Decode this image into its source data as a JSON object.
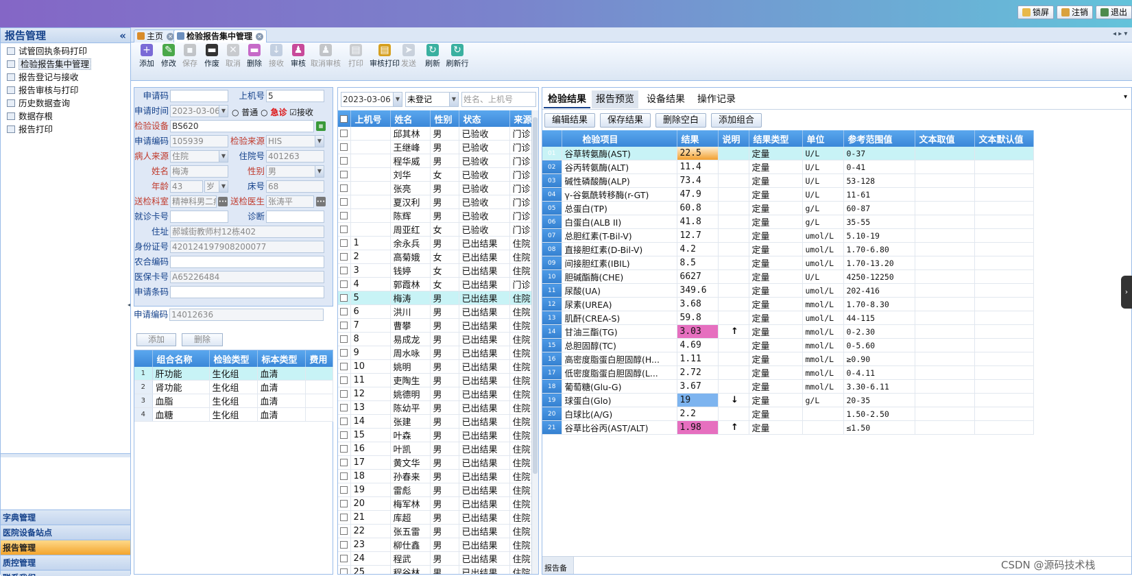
{
  "top_buttons": [
    "锁屏",
    "注销",
    "退出"
  ],
  "sidebar": {
    "title": "报告管理",
    "collapse": "«",
    "items": [
      {
        "label": "试管回执条码打印"
      },
      {
        "label": "检验报告集中管理"
      },
      {
        "label": "报告登记与接收"
      },
      {
        "label": "报告审核与打印"
      },
      {
        "label": "历史数据查询"
      },
      {
        "label": "数据存根"
      },
      {
        "label": "报告打印"
      }
    ],
    "sections": [
      "字典管理",
      "医院设备站点",
      "报告管理",
      "质控管理",
      "联系我们"
    ]
  },
  "tabs": [
    {
      "label": "主页"
    },
    {
      "label": "检验报告集中管理"
    }
  ],
  "toolbar": [
    {
      "label": "添加",
      "icon": "add-icon",
      "color": "#7a6ad6",
      "enabled": true
    },
    {
      "label": "修改",
      "icon": "pencil-icon",
      "color": "#4aa84a",
      "enabled": true
    },
    {
      "label": "保存",
      "icon": "save-icon",
      "color": "#8a8a8a",
      "enabled": false
    },
    {
      "label": "作废",
      "icon": "trash-icon",
      "color": "#333333",
      "enabled": true
    },
    {
      "label": "取消",
      "icon": "cancel-icon",
      "color": "#999999",
      "enabled": false
    },
    {
      "label": "删除",
      "icon": "delete-icon",
      "color": "#c66ac8",
      "enabled": true
    },
    {
      "label": "接收",
      "icon": "receive-icon",
      "color": "#8aa0c0",
      "enabled": false
    },
    {
      "label": "审核",
      "icon": "approve-icon",
      "color": "#c84a9a",
      "enabled": true
    },
    {
      "label": "取消审核",
      "icon": "unapprove-icon",
      "color": "#8a8a8a",
      "enabled": false
    },
    {
      "label": "打印",
      "icon": "print-icon",
      "color": "#9a9a9a",
      "enabled": false
    },
    {
      "label": "审核打印",
      "icon": "approve-print-icon",
      "color": "#d6a020",
      "enabled": true
    },
    {
      "label": "发送",
      "icon": "send-icon",
      "color": "#9aa6b6",
      "enabled": false
    },
    {
      "label": "刷新",
      "icon": "refresh-icon",
      "color": "#3ab0a0",
      "enabled": true
    },
    {
      "label": "刷新行",
      "icon": "refresh-row-icon",
      "color": "#3ab0a0",
      "enabled": true
    }
  ],
  "form": {
    "apply_code_label": "申请码",
    "apply_code": "",
    "machine_no_label": "上机号",
    "machine_no": "5",
    "apply_time_label": "申请时间",
    "apply_time": "2023-03-06",
    "normal_label": "普通",
    "urgent_label": "急诊",
    "receive_label": "接收",
    "device_label": "检验设备",
    "device": "BS620",
    "apply_number_label": "申请编码",
    "apply_number": "105939",
    "source_label": "检验来源",
    "source": "HIS",
    "patient_source_label": "病人来源",
    "patient_source": "住院",
    "inpatient_no_label": "住院号",
    "inpatient_no": "401263",
    "name_label": "姓名",
    "name": "梅涛",
    "sex_label": "性别",
    "sex": "男",
    "age_label": "年龄",
    "age": "43",
    "age_unit": "岁",
    "bed_label": "床号",
    "bed": "68",
    "dept_label": "送检科室",
    "dept": "精神科男二病",
    "doctor_label": "送检医生",
    "doctor": "张涛平",
    "card_label": "就诊卡号",
    "card": "",
    "diagnosis_label": "诊断",
    "diagnosis": "",
    "address_label": "住址",
    "address": "郝城街教师村12栋402",
    "id_label": "身份证号",
    "id": "420124197908200077",
    "rural_label": "农合编码",
    "rural": "",
    "insurance_label": "医保卡号",
    "insurance": "A65226484",
    "barcode_label": "申请条码",
    "barcode": "",
    "apply_code2_label": "申请编码",
    "apply_code2": "14012636",
    "add_btn": "添加",
    "del_btn": "删除"
  },
  "combo_grid": {
    "headers": [
      "组合名称",
      "检验类型",
      "标本类型",
      "费用"
    ],
    "rows": [
      [
        "1",
        "肝功能",
        "生化组",
        "血清",
        ""
      ],
      [
        "2",
        "肾功能",
        "生化组",
        "血清",
        ""
      ],
      [
        "3",
        "血脂",
        "生化组",
        "血清",
        ""
      ],
      [
        "4",
        "血糖",
        "生化组",
        "血清",
        ""
      ]
    ]
  },
  "filter": {
    "date": "2023-03-06",
    "status": "未登记",
    "search_placeholder": "姓名、上机号"
  },
  "patient_list": {
    "headers": [
      "上机号",
      "姓名",
      "性别",
      "状态",
      "来源"
    ],
    "rows": [
      [
        "",
        "邱其林",
        "男",
        "已验收",
        "门诊"
      ],
      [
        "",
        "王继峰",
        "男",
        "已验收",
        "门诊"
      ],
      [
        "",
        "程华威",
        "男",
        "已验收",
        "门诊"
      ],
      [
        "",
        "刘华",
        "女",
        "已验收",
        "门诊"
      ],
      [
        "",
        "张亮",
        "男",
        "已验收",
        "门诊"
      ],
      [
        "",
        "夏汉利",
        "男",
        "已验收",
        "门诊"
      ],
      [
        "",
        "陈辉",
        "男",
        "已验收",
        "门诊"
      ],
      [
        "",
        "周亚红",
        "女",
        "已验收",
        "门诊"
      ],
      [
        "1",
        "余永兵",
        "男",
        "已出结果",
        "住院"
      ],
      [
        "2",
        "高菊娥",
        "女",
        "已出结果",
        "住院"
      ],
      [
        "3",
        "钱婷",
        "女",
        "已出结果",
        "住院"
      ],
      [
        "4",
        "郭霞林",
        "女",
        "已出结果",
        "门诊"
      ],
      [
        "5",
        "梅涛",
        "男",
        "已出结果",
        "住院"
      ],
      [
        "6",
        "洪川",
        "男",
        "已出结果",
        "住院"
      ],
      [
        "7",
        "曹攀",
        "男",
        "已出结果",
        "住院"
      ],
      [
        "8",
        "易成龙",
        "男",
        "已出结果",
        "住院"
      ],
      [
        "9",
        "周水咏",
        "男",
        "已出结果",
        "住院"
      ],
      [
        "10",
        "姚明",
        "男",
        "已出结果",
        "住院"
      ],
      [
        "11",
        "吏陶生",
        "男",
        "已出结果",
        "住院"
      ],
      [
        "12",
        "姚德明",
        "男",
        "已出结果",
        "住院"
      ],
      [
        "13",
        "陈幼平",
        "男",
        "已出结果",
        "住院"
      ],
      [
        "14",
        "张建",
        "男",
        "已出结果",
        "住院"
      ],
      [
        "15",
        "叶森",
        "男",
        "已出结果",
        "住院"
      ],
      [
        "16",
        "叶凯",
        "男",
        "已出结果",
        "住院"
      ],
      [
        "17",
        "黄文华",
        "男",
        "已出结果",
        "住院"
      ],
      [
        "18",
        "孙春来",
        "男",
        "已出结果",
        "住院"
      ],
      [
        "19",
        "雷彪",
        "男",
        "已出结果",
        "住院"
      ],
      [
        "20",
        "梅军林",
        "男",
        "已出结果",
        "住院"
      ],
      [
        "21",
        "库超",
        "男",
        "已出结果",
        "住院"
      ],
      [
        "22",
        "张五雷",
        "男",
        "已出结果",
        "住院"
      ],
      [
        "23",
        "柳仕鑫",
        "男",
        "已出结果",
        "住院"
      ],
      [
        "24",
        "程武",
        "男",
        "已出结果",
        "住院"
      ],
      [
        "25",
        "程谷林",
        "男",
        "已出结果",
        "住院"
      ]
    ],
    "selected_index": 12
  },
  "results": {
    "tabs": [
      "检验结果",
      "报告预览",
      "设备结果",
      "操作记录"
    ],
    "buttons": [
      "编辑结果",
      "保存结果",
      "删除空白",
      "添加组合"
    ],
    "headers": [
      "检验项目",
      "结果",
      "说明",
      "结果类型",
      "单位",
      "参考范围值",
      "文本取值",
      "文本默认值"
    ],
    "rows": [
      [
        "01",
        "谷草转氨酶(AST)",
        "22.5",
        "",
        "定量",
        "U/L",
        "0-37"
      ],
      [
        "02",
        "谷丙转氨酶(ALT)",
        "11.4",
        "",
        "定量",
        "U/L",
        "0-41"
      ],
      [
        "03",
        "碱性磷酸酶(ALP)",
        "73.4",
        "",
        "定量",
        "U/L",
        "53-128"
      ],
      [
        "04",
        "γ-谷氨酰转移酶(r-GT)",
        "47.9",
        "",
        "定量",
        "U/L",
        "11-61"
      ],
      [
        "05",
        "总蛋白(TP)",
        "60.8",
        "",
        "定量",
        "g/L",
        "60-87"
      ],
      [
        "06",
        "白蛋白(ALB II)",
        "41.8",
        "",
        "定量",
        "g/L",
        "35-55"
      ],
      [
        "07",
        "总胆红素(T-Bil-V)",
        "12.7",
        "",
        "定量",
        "umol/L",
        "5.10-19"
      ],
      [
        "08",
        "直接胆红素(D-Bil-V)",
        "4.2",
        "",
        "定量",
        "umol/L",
        "1.70-6.80"
      ],
      [
        "09",
        "间接胆红素(IBIL)",
        "8.5",
        "",
        "定量",
        "umol/L",
        "1.70-13.20"
      ],
      [
        "10",
        "胆碱酯酶(CHE)",
        "6627",
        "",
        "定量",
        "U/L",
        "4250-12250"
      ],
      [
        "11",
        "尿酸(UA)",
        "349.6",
        "",
        "定量",
        "umol/L",
        "202-416"
      ],
      [
        "12",
        "尿素(UREA)",
        "3.68",
        "",
        "定量",
        "mmol/L",
        "1.70-8.30"
      ],
      [
        "13",
        "肌酐(CREA-S)",
        "59.8",
        "",
        "定量",
        "umol/L",
        "44-115"
      ],
      [
        "14",
        "甘油三酯(TG)",
        "3.03",
        "↑",
        "定量",
        "mmol/L",
        "0-2.30"
      ],
      [
        "15",
        "总胆固醇(TC)",
        "4.69",
        "",
        "定量",
        "mmol/L",
        "0-5.60"
      ],
      [
        "16",
        "高密度脂蛋白胆固醇(H...",
        "1.11",
        "",
        "定量",
        "mmol/L",
        "≥0.90"
      ],
      [
        "17",
        "低密度脂蛋白胆固醇(L...",
        "2.72",
        "",
        "定量",
        "mmol/L",
        "0-4.11"
      ],
      [
        "18",
        "葡萄糖(Glu-G)",
        "3.67",
        "",
        "定量",
        "mmol/L",
        "3.30-6.11"
      ],
      [
        "19",
        "球蛋白(Glo)",
        "19",
        "↓",
        "定量",
        "g/L",
        "20-35"
      ],
      [
        "20",
        "白球比(A/G)",
        "2.2",
        "",
        "定量",
        "",
        "1.50-2.50"
      ],
      [
        "21",
        "谷草比谷丙(AST/ALT)",
        "1.98",
        "↑",
        "定量",
        "",
        "≤1.50"
      ]
    ],
    "footer": "报告备注"
  },
  "watermark": "CSDN @源码技术栈",
  "colors": {
    "high": "#e66fbf",
    "low": "#7db4ef",
    "selected_row": "#c8f3f6",
    "accent": "#f2a030"
  }
}
